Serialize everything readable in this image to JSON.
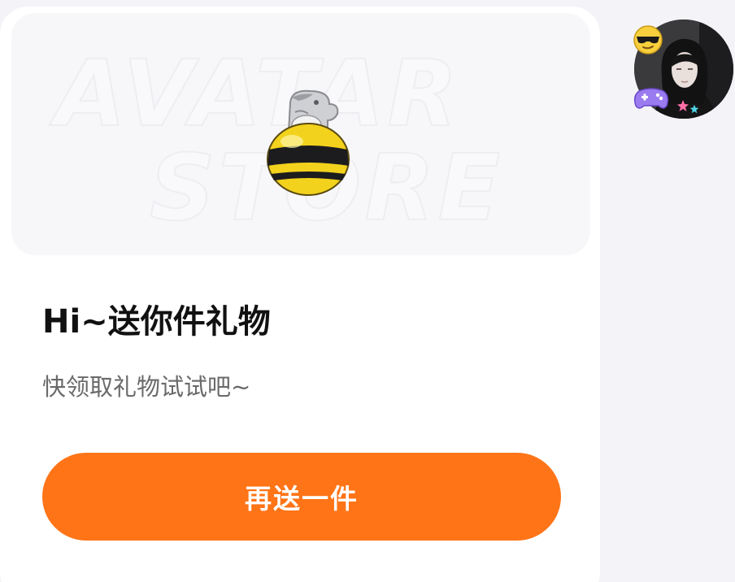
{
  "card": {
    "banner_watermark_line1": "AVATAR",
    "banner_watermark_line2": "STORE",
    "title": "Hi~送你件礼物",
    "subtitle": "快领取礼物试试吧~",
    "cta_label": "再送一件"
  },
  "icons": {
    "gift": "bee-figure-icon",
    "avatar_decorations": [
      "sunglasses-emoji-icon",
      "gamepad-icon",
      "star-icon"
    ]
  },
  "colors": {
    "accent": "#ff7417",
    "title": "#111111",
    "subtitle": "#6a6a6a",
    "card_bg": "#ffffff",
    "page_bg": "#f3f3f8"
  }
}
